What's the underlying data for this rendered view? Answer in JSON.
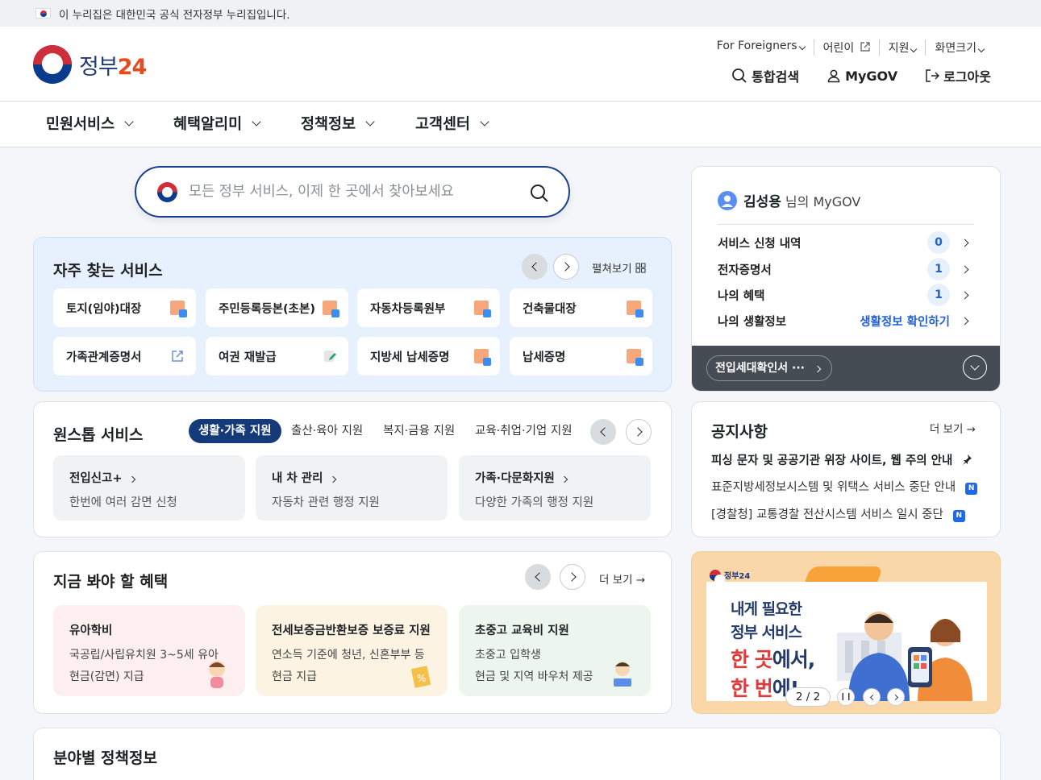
{
  "gov_bar": {
    "text": "이 누리집은 대한민국 공식 전자정부 누리집입니다."
  },
  "logo": {
    "text_a": "정부",
    "text_b": "24"
  },
  "util_menu": [
    "For Foreigners",
    "어린이",
    "지원",
    "화면크기"
  ],
  "main_actions": {
    "search": "통합검색",
    "mygov": "MyGOV",
    "logout": "로그아웃"
  },
  "gnb": [
    "민원서비스",
    "혜택알리미",
    "정책정보",
    "고객센터"
  ],
  "search": {
    "placeholder": "모든 정부 서비스, 이제 한 곳에서 찾아보세요"
  },
  "frequent": {
    "title": "자주 찾는 서비스",
    "expand": "펼쳐보기",
    "items": [
      "토지(임야)대장",
      "주민등록등본(초본)",
      "자동차등록원부",
      "건축물대장",
      "가족관계증명서",
      "여권 재발급",
      "지방세 납세증명",
      "납세증명"
    ]
  },
  "onestop": {
    "title": "원스톱 서비스",
    "tabs": [
      "생활·가족 지원",
      "출산·육아 지원",
      "복지·금융 지원",
      "교육·취업·기업 지원"
    ],
    "items": [
      {
        "title": "전입신고+",
        "desc": "한번에 여러 감면 신청"
      },
      {
        "title": "내 차 관리",
        "desc": "자동차 관련 행정 지원"
      },
      {
        "title": "가족·다문화지원",
        "desc": "다양한 가족의 행정 지원"
      }
    ]
  },
  "benefits": {
    "title": "지금 봐야 할 혜택",
    "more": "더 보기",
    "items": [
      {
        "title": "유아학비",
        "line1": "국공립/사립유치원 3~5세 유아",
        "line2": "현금(감면) 지급",
        "bg": "#fdeff0"
      },
      {
        "title": "전세보증금반환보증 보증료 지원",
        "line1": "연소득 기준에 청년, 신혼부부 등",
        "line2": "현금 지급",
        "bg": "#fdf3e3"
      },
      {
        "title": "초중고 교육비 지원",
        "line1": "초중고 입학생",
        "line2": "현금 및 지역 바우처 제공",
        "bg": "#ecf6ee"
      }
    ]
  },
  "field": {
    "title": "분야별 정책정보"
  },
  "mygov": {
    "name": "김성용",
    "suffix": "님의 MyGOV",
    "rows": [
      {
        "label": "서비스 신청 내역",
        "count": "0"
      },
      {
        "label": "전자증명서",
        "count": "1"
      },
      {
        "label": "나의 혜택",
        "count": "1"
      },
      {
        "label": "나의 생활정보",
        "link": "생활정보 확인하기"
      }
    ],
    "pill": "전입세대확인서 ···"
  },
  "notice": {
    "title": "공지사항",
    "more": "더 보기",
    "items": [
      "피싱 문자 및 공공기관 위장 사이트, 웹 주의 안내",
      "표준지방세정보시스템 및 위택스 서비스 중단 안내",
      "[경찰청] 교통경찰 전산시스템 서비스 일시 중단"
    ],
    "new_badge": "N"
  },
  "banner": {
    "logo_text": "정부24",
    "line1": "내게 필요한",
    "line2": "정부 서비스",
    "line3a": "한 곳",
    "line3b": "에서,",
    "line4a": "한 번",
    "line4b": "에!",
    "pager": "2 / 2"
  },
  "colors": {
    "primary": "#1b3f8f",
    "accent": "#2060d8",
    "brand_red": "#cd2e3a"
  }
}
